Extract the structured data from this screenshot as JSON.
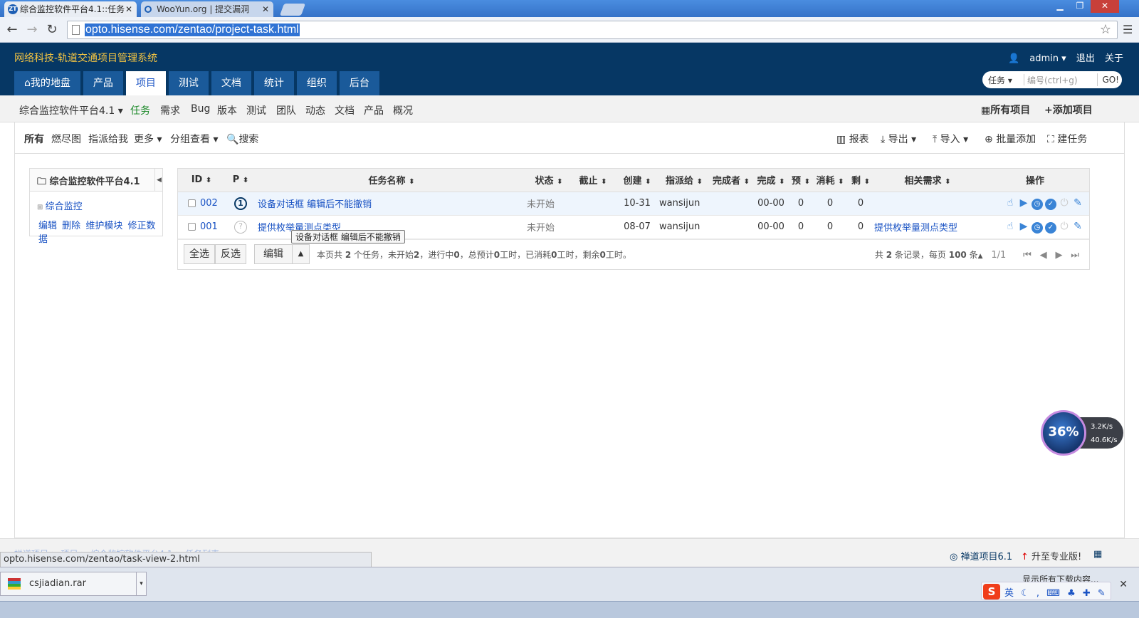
{
  "browser": {
    "tabs": [
      {
        "title": "综合监控软件平台4.1::任务",
        "favicon": "ZT",
        "active": true
      },
      {
        "title": "WooYun.org | 提交漏洞",
        "active": false
      }
    ],
    "url": "opto.hisense.com/zentao/project-task.html",
    "status_url": "opto.hisense.com/zentao/task-view-2.html"
  },
  "header": {
    "brand": "网络科技-轨道交通项目管理系统",
    "user": "admin",
    "logout": "退出",
    "about": "关于",
    "nav": [
      "我的地盘",
      "产品",
      "项目",
      "测试",
      "文档",
      "统计",
      "组织",
      "后台"
    ],
    "active_nav": "项目",
    "search": {
      "type": "任务",
      "placeholder": "编号(ctrl+g)",
      "go": "GO!"
    }
  },
  "subnav": {
    "project": "综合监控软件平台4.1",
    "items": [
      "任务",
      "需求",
      "Bug",
      "版本",
      "测试",
      "团队",
      "动态",
      "文档",
      "产品",
      "概况"
    ],
    "active": "任务",
    "all_projects": "所有项目",
    "add_project": "添加项目"
  },
  "featurebar": {
    "left": [
      "所有",
      "燃尽图",
      "指派给我",
      "更多",
      "分组查看",
      "搜索"
    ],
    "right": [
      "报表",
      "导出",
      "导入",
      "批量添加",
      "建任务"
    ]
  },
  "sidebar": {
    "title": "综合监控软件平台4.1",
    "module": "综合监控",
    "actions": [
      "编辑",
      "删除",
      "维护模块",
      "修正数据"
    ]
  },
  "table": {
    "columns": [
      "ID",
      "P",
      "任务名称",
      "状态",
      "截止",
      "创建",
      "指派给",
      "完成者",
      "完成",
      "预",
      "消耗",
      "剩",
      "相关需求",
      "操作"
    ],
    "rows": [
      {
        "id": "002",
        "pri": "1",
        "name": "设备对话框 编辑后不能撤销",
        "status": "未开始",
        "deadline": "",
        "created": "10-31",
        "assigned": "wansijun",
        "finishedBy": "",
        "finished": "00-00",
        "estimate": "0",
        "consumed": "0",
        "left": "0",
        "story": ""
      },
      {
        "id": "001",
        "pri": "?",
        "name": "提供枚举量测点类型",
        "status": "未开始",
        "deadline": "",
        "created": "08-07",
        "assigned": "wansijun",
        "finishedBy": "",
        "finished": "00-00",
        "estimate": "0",
        "consumed": "0",
        "left": "0",
        "story": "提供枚举量测点类型"
      }
    ],
    "tooltip": "设备对话框 编辑后不能撤销"
  },
  "footer_table": {
    "select_all": "全选",
    "invert": "反选",
    "edit": "编辑",
    "summary_parts": [
      "本页共 ",
      "2",
      " 个任务，未开始",
      "2",
      "，进行中",
      "0",
      "，总预计",
      "0",
      "工时，已消耗",
      "0",
      "工时，剩余",
      "0",
      "工时。"
    ],
    "records_prefix": "共 ",
    "records_count": "2",
    "records_mid": " 条记录，每页 ",
    "per_page": "100",
    "records_suffix": " 条",
    "page": "1/1"
  },
  "footer": {
    "crumbs": "禅道项目 > 项目 > 综合监控软件平台4.1 > 任务列表",
    "version": "禅道项目6.1",
    "upgrade": "升至专业版!"
  },
  "downloads": {
    "file": "csjiadian.rar",
    "show_all": "显示所有下载内容..."
  },
  "ime": {
    "logo": "S",
    "mode": "英"
  },
  "w360": {
    "percent": "36%",
    "up": "3.2K/s",
    "down": "40.6K/s"
  }
}
